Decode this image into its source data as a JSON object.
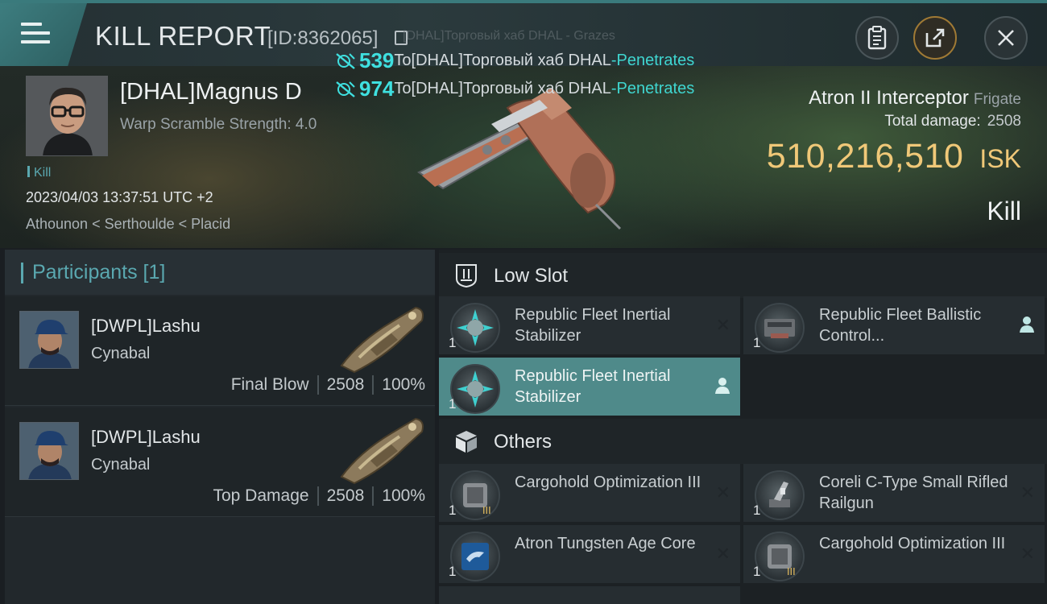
{
  "header": {
    "title": "KILL REPORT",
    "report_id": "[ID:8362065]",
    "ghost_text": "[DHAL]Торговый хаб DHAL - Grazes"
  },
  "damage_feed": [
    {
      "amount": "539",
      "text": "To[DHAL]Торговый хаб DHAL ",
      "effect": "-Penetrates"
    },
    {
      "amount": "974",
      "text": "To[DHAL]Торговый хаб DHAL ",
      "effect": "-Penetrates"
    }
  ],
  "victim": {
    "name": "[DHAL]Magnus D",
    "warp_scramble": "Warp Scramble Strength: 4.0",
    "tag": "Kill",
    "datetime": "2023/04/03 13:37:51 UTC +2",
    "location": "Athounon < Serthoulde < Placid"
  },
  "ship": {
    "name": "Atron II Interceptor",
    "class": "Frigate",
    "total_damage_label": "Total damage:",
    "total_damage": "2508",
    "isk_value": "510,216,510",
    "isk_unit": "ISK",
    "result": "Kill"
  },
  "participants": {
    "label": "Participants [1]",
    "rows": [
      {
        "name": "[DWPL]Lashu",
        "ship": "Cynabal",
        "role": "Final Blow",
        "damage": "2508",
        "percent": "100%"
      },
      {
        "name": "[DWPL]Lashu",
        "ship": "Cynabal",
        "role": "Top Damage",
        "damage": "2508",
        "percent": "100%"
      }
    ]
  },
  "low_slot": {
    "label": "Low Slot",
    "items": [
      {
        "qty": "1",
        "name": "Republic Fleet Inertial Stabilizer",
        "status": "destroyed"
      },
      {
        "qty": "1",
        "name": "Republic Fleet Ballistic Control...",
        "status": "dropped"
      },
      {
        "qty": "1",
        "name": "Republic Fleet Inertial Stabilizer",
        "status": "dropped"
      }
    ]
  },
  "others": {
    "label": "Others",
    "items": [
      {
        "qty": "1",
        "name": "Cargohold Optimization III",
        "status": "destroyed"
      },
      {
        "qty": "1",
        "name": "Coreli C-Type Small Rifled Railgun",
        "status": "destroyed"
      },
      {
        "qty": "1",
        "name": "Atron Tungsten Age Core",
        "status": "destroyed"
      },
      {
        "qty": "1",
        "name": "Cargohold Optimization III",
        "status": "destroyed"
      }
    ]
  },
  "colors": {
    "accent": "#5aa8b0",
    "isk": "#f0c878",
    "damage": "#3fe0e0",
    "active_item": "#4f8a8a"
  }
}
